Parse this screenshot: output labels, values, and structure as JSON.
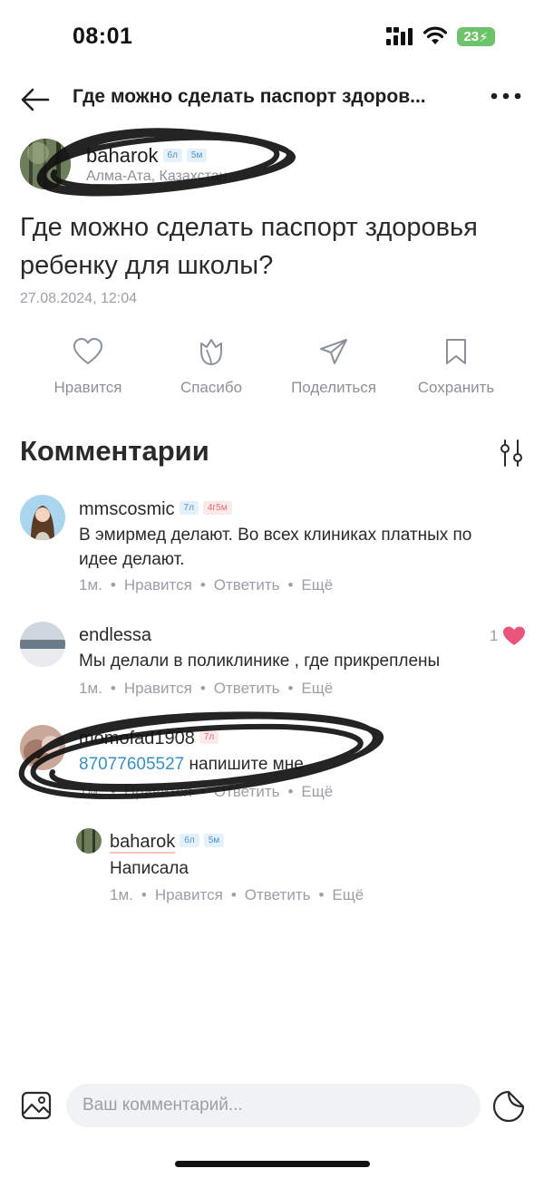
{
  "status_bar": {
    "time": "08:01",
    "battery": "23"
  },
  "header": {
    "title": "Где можно сделать паспорт здоров..."
  },
  "post": {
    "author": "baharok",
    "author_badges": [
      "6л",
      "5м"
    ],
    "location": "Алма-Ата, Казахстан",
    "question": "Где можно сделать паспорт здоровья ребенку для школы?",
    "date": "27.08.2024, 12:04"
  },
  "actions": [
    {
      "label": "Нравится",
      "icon": "heart-icon"
    },
    {
      "label": "Спасибо",
      "icon": "tulip-icon"
    },
    {
      "label": "Поделиться",
      "icon": "send-icon"
    },
    {
      "label": "Сохранить",
      "icon": "bookmark-icon"
    }
  ],
  "comments_section": {
    "title": "Комментарии"
  },
  "comments": [
    {
      "author": "mmscosmic",
      "badges": [
        "7л",
        "4г5м"
      ],
      "text": "В эмирмед делают. Во всех клиниках платных по идее делают.",
      "time": "1м.",
      "like": "Нравится",
      "reply": "Ответить",
      "more": "Ещё"
    },
    {
      "author": "endlessa",
      "text": "Мы делали в поликлинике , где прикреплены",
      "likes": "1",
      "time": "1м.",
      "like": "Нравится",
      "reply": "Ответить",
      "more": "Ещё"
    },
    {
      "author": "momofad1908",
      "badges": [
        "7л"
      ],
      "phone": "87077605527",
      "text": "напишите мне",
      "time": "1м.",
      "like": "Нравится",
      "reply": "Ответить",
      "more": "Ещё"
    },
    {
      "author": "baharok",
      "badges": [
        "6л",
        "5м"
      ],
      "text": "Написала",
      "time": "1м.",
      "like": "Нравится",
      "reply": "Ответить",
      "more": "Ещё"
    }
  ],
  "composer": {
    "placeholder": "Ваш комментарий..."
  },
  "colors": {
    "accent_blue": "#3a8fc2",
    "like_pink": "#e8557a",
    "muted": "#9aa0a6"
  }
}
